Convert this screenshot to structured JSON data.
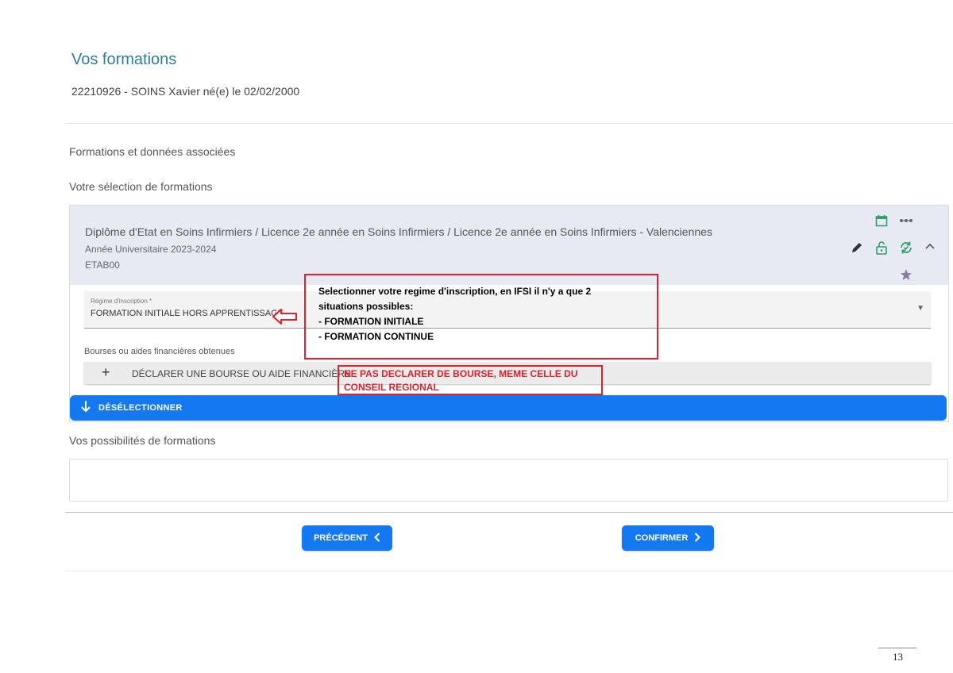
{
  "page": {
    "title": "Vos formations",
    "student_line": "22210926 - SOINS Xavier né(e) le 02/02/2000"
  },
  "section": {
    "title": "Formations et données associées",
    "selection_title": "Votre sélection de formations"
  },
  "formation": {
    "title": "Diplôme d'Etat en Soins Infirmiers / Licence 2e année en Soins Infirmiers / Licence 2e année en Soins Infirmiers - Valenciennes",
    "year": "Année Universitaire 2023-2024",
    "code": "ETAB00",
    "icons": [
      "calendar-icon",
      "more-icon",
      "edit-icon",
      "unlock-icon",
      "sync-icon",
      "chevron-up-icon",
      "star-icon"
    ]
  },
  "regime": {
    "label": "Régime d'inscription *",
    "value": "FORMATION INITIALE HORS APPRENTISSAGE"
  },
  "bourses": {
    "label": "Bourses ou aides financières obtenues",
    "declare_button": "DÉCLARER UNE BOURSE OU AIDE FINANCIÈRE"
  },
  "deselect": {
    "label": "DÉSÉLECTIONNER"
  },
  "possibilities": {
    "title": "Vos possibilités de formations"
  },
  "nav": {
    "prev_label": "PRÉCÉDENT",
    "confirm_label": "CONFIRMER"
  },
  "annotations": {
    "regime_line1": "Selectionner votre regime d'inscription, en IFSI il n'y a que 2",
    "regime_line2": "situations possibles:",
    "regime_line3": "- FORMATION INITIALE",
    "regime_line4": "- FORMATION CONTINUE",
    "bourse_line1": "NE PAS DECLARER DE BOURSE, MEME CELLE DU",
    "bourse_line2": "CONSEIL REGIONAL"
  },
  "footer": {
    "page_number": "13"
  },
  "colors": {
    "primary": "#1479f0",
    "title": "#2e7d9a",
    "icon_green": "#2e9e6a",
    "annotation_red": "#e0202a",
    "card_header": "#e8eaf3"
  }
}
